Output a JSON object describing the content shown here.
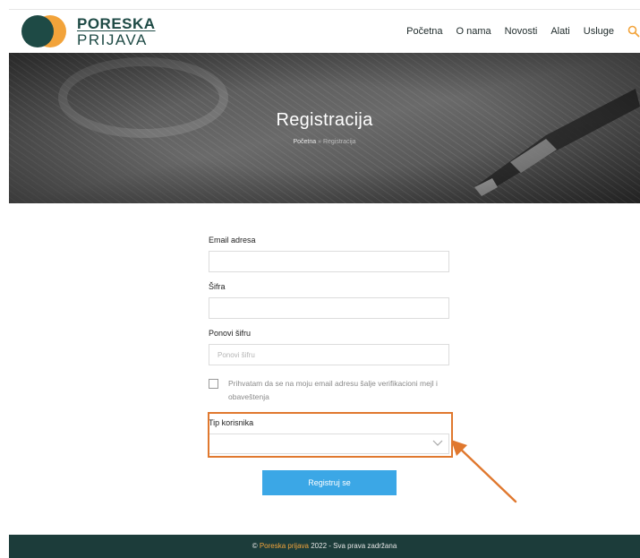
{
  "brand": {
    "line1": "PORESKA",
    "line2": "PRIJAVA",
    "colors": {
      "dark_green": "#1e4a45",
      "orange": "#f2a33a",
      "red": "#e4572e"
    }
  },
  "nav": {
    "items": [
      {
        "label": "Početna"
      },
      {
        "label": "O nama"
      },
      {
        "label": "Novosti"
      },
      {
        "label": "Alati"
      },
      {
        "label": "Usluge"
      }
    ],
    "search_icon": "search-icon",
    "accent": "#f2a33a"
  },
  "hero": {
    "title": "Registracija",
    "breadcrumb": {
      "home": "Početna",
      "separator": "»",
      "current": "Registracija"
    }
  },
  "form": {
    "email": {
      "label": "Email adresa",
      "value": "",
      "placeholder": ""
    },
    "password": {
      "label": "Šifra",
      "value": "",
      "placeholder": ""
    },
    "repeat_password": {
      "label": "Ponovi šifru",
      "value": "",
      "placeholder": "Ponovi šifru"
    },
    "consent": {
      "text": "Prihvatam da se na moju email adresu šalje verifikacioni mejl i obaveštenja",
      "checked": false
    },
    "user_type": {
      "label": "Tip korisnika",
      "selected": ""
    },
    "submit_label": "Registruj se",
    "submit_color": "#3ba7e6"
  },
  "annotation": {
    "highlight_color": "#e0782e"
  },
  "footer": {
    "prefix": "©",
    "brand": "Poreska prijava",
    "suffix": "2022 - Sva prava zadržana",
    "bg": "#1c3c3a"
  }
}
